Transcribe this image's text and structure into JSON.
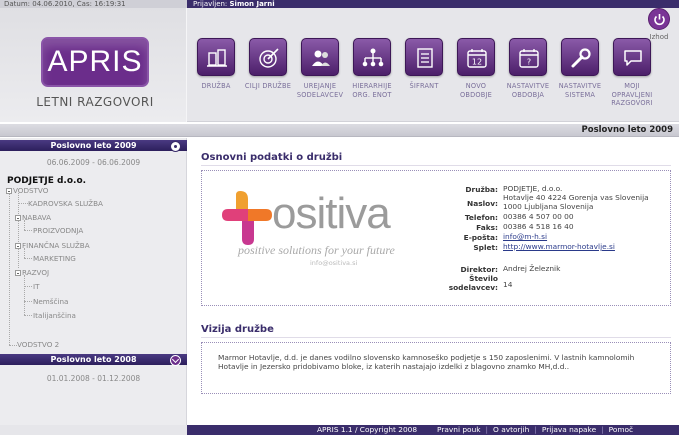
{
  "topbar": {
    "datetime": "Datum: 04.06.2010, Čas: 16:19:31",
    "logged_prefix": "Prijavljen: ",
    "user": "Simon Jarni"
  },
  "brand": {
    "logo_text": "APRIS",
    "subtitle": "LETNI RAZGOVORI"
  },
  "nav": {
    "items": [
      {
        "label": "DRUŽBA",
        "icon": "company-icon"
      },
      {
        "label": "CILJI DRUŽBE",
        "icon": "target-icon"
      },
      {
        "label": "UREJANJE SODELAVCEV",
        "icon": "users-icon"
      },
      {
        "label": "HIERARHIJE ORG. ENOT",
        "icon": "hierarchy-icon"
      },
      {
        "label": "ŠIFRANT",
        "icon": "list-icon"
      },
      {
        "label": "NOVO OBDOBJE",
        "icon": "calendar-new-icon"
      },
      {
        "label": "NASTAVITVE OBDOBJA",
        "icon": "calendar-settings-icon"
      },
      {
        "label": "NASTAVITVE SISTEMA",
        "icon": "wrench-icon"
      },
      {
        "label": "MOJI OPRAVLJENI RAZGOVORI",
        "icon": "chat-icon"
      }
    ],
    "calendar_number": "12",
    "calendar_mark": "?",
    "logout_label": "Izhod"
  },
  "breadcrumb": "Poslovno leto 2009",
  "sidebar": {
    "year_2009": {
      "title": "Poslovno leto 2009",
      "dates": "06.06.2009 - 06.06.2009"
    },
    "company": "PODJETJE d.o.o.",
    "tree": [
      "VODSTVO",
      "KADROVSKA SLUŽBA",
      "NABAVA",
      "PROIZVODNJA",
      "FINANČNA SLUŽBA",
      "MARKETING",
      "RAZVOJ",
      "IT",
      "Nemščina",
      "Italijanščina",
      "VODSTVO 2"
    ],
    "year_2008": {
      "title": "Poslovno leto 2008",
      "dates": "01.01.2008 - 01.12.2008"
    }
  },
  "main": {
    "basic_title": "Osnovni podatki o družbi",
    "logo": {
      "word": "ositiva",
      "tagline": "positive solutions for your future",
      "mail": "info@ositiva.si"
    },
    "fields": [
      {
        "key": "Družba:",
        "value": "PODJETJE, d.o.o."
      },
      {
        "key": "Naslov:",
        "value": "Hotavlje 40 4224 Gorenja vas Slovenija\n1000 Ljubljana Slovenija"
      },
      {
        "key": "Telefon:",
        "value": "00386 4 507 00 00"
      },
      {
        "key": "Faks:",
        "value": "00386 4 518 16 40"
      },
      {
        "key": "E-pošta:",
        "value": "info@m-h.si"
      },
      {
        "key": "Splet:",
        "value": "http://www.marmor-hotavlje.si"
      },
      {
        "key": "Direktor:",
        "value": "Andrej Železnik"
      },
      {
        "key": "Število sodelavcev:",
        "value": "14"
      }
    ],
    "vision_title": "Vizija družbe",
    "vision_text": "Marmor Hotavlje, d.d. je danes vodilno slovensko kamnoseško podjetje s 150 zaposlenimi. V lastnih kamnolomih Hotavlje in Jezersko pridobivamo bloke, iz katerih nastajajo izdelki z blagovno znamko MH,d.d.."
  },
  "footer": {
    "copyright": "APRIS 1.1 / Copyright 2008",
    "links": [
      "Pravni pouk",
      "O avtorjih",
      "Prijava napake",
      "Pomoč"
    ]
  },
  "colors": {
    "brand_purple": "#6b2d8b",
    "header_navy": "#3a2d6b",
    "accent_pink": "#e0407a",
    "accent_orange": "#f0a030"
  }
}
